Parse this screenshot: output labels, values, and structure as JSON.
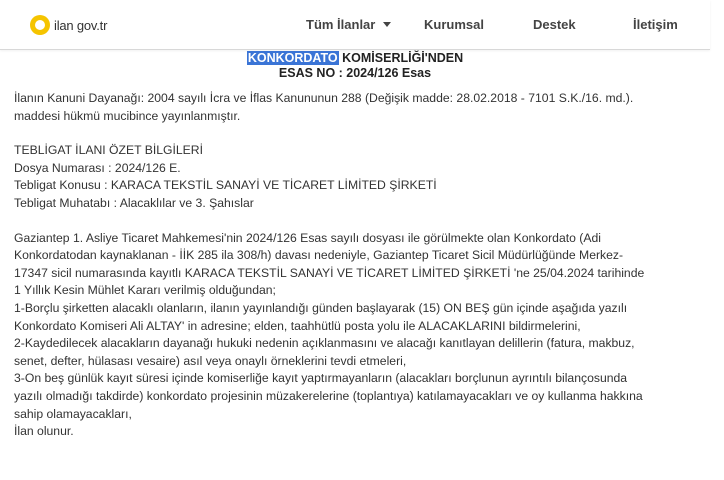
{
  "header": {
    "logo_text": "ilan gov.tr",
    "nav": [
      {
        "label": "Tüm İlanlar"
      },
      {
        "label": "Kurumsal"
      },
      {
        "label": "Destek"
      },
      {
        "label": "İletişim"
      }
    ]
  },
  "title": {
    "highlighted": "KONKORDATO",
    "rest": " KOMİSERLİĞİ'NDEN",
    "esas": "ESAS NO : 2024/126 Esas"
  },
  "legal_basis": [
    "İlanın Kanuni Dayanağı: 2004 sayılı İcra ve İflas Kanununun 288 (Değişik madde: 28.02.2018 - 7101 S.K./16. md.).",
    "maddesi hükmü mucibince yayınlanmıştır."
  ],
  "summary": [
    "TEBLİGAT İLANI ÖZET BİLGİLERİ",
    "Dosya Numarası : 2024/126 E.",
    "Tebligat Konusu : KARACA TEKSTİL SANAYİ VE TİCARET LİMİTED ŞİRKETİ",
    "Tebligat Muhatabı : Alacaklılar ve 3. Şahıslar"
  ],
  "body": [
    "Gaziantep 1. Asliye Ticaret Mahkemesi'nin 2024/126 Esas sayılı dosyası ile görülmekte olan Konkordato (Adi",
    "Konkordatodan kaynaklanan - İİK 285 ila 308/h) davası nedeniyle, Gaziantep Ticaret Sicil Müdürlüğünde Merkez-",
    "17347 sicil numarasında kayıtlı KARACA TEKSTİL SANAYİ VE TİCARET LİMİTED ŞİRKETİ 'ne 25/04.2024 tarihinde",
    "1 Yıllık Kesin Mühlet Kararı verilmiş olduğundan;",
    "1-Borçlu şirketten alacaklı olanların, ilanın yayınlandığı günden başlayarak (15) ON BEŞ gün içinde aşağıda yazılı",
    "Konkordato Komiseri Ali ALTAY' in adresine; elden, taahhütlü posta yolu ile ALACAKLARINI bildirmelerini,",
    "2-Kaydedilecek alacakların dayanağı hukuki nedenin açıklanmasını ve alacağı kanıtlayan delillerin (fatura, makbuz,",
    "senet, defter, hülasası vesaire) asıl veya onaylı örneklerini tevdi etmeleri,",
    "3-On beş günlük kayıt süresi içinde komiserliğe kayıt yaptırmayanların (alacakları borçlunun ayrıntılı bilançosunda",
    "yazılı olmadığı takdirde) konkordato projesinin müzakerelerine (toplantıya) katılamayacakları ve oy kullanma hakkına",
    "sahip olamayacakları,",
    "İlan olunur."
  ]
}
